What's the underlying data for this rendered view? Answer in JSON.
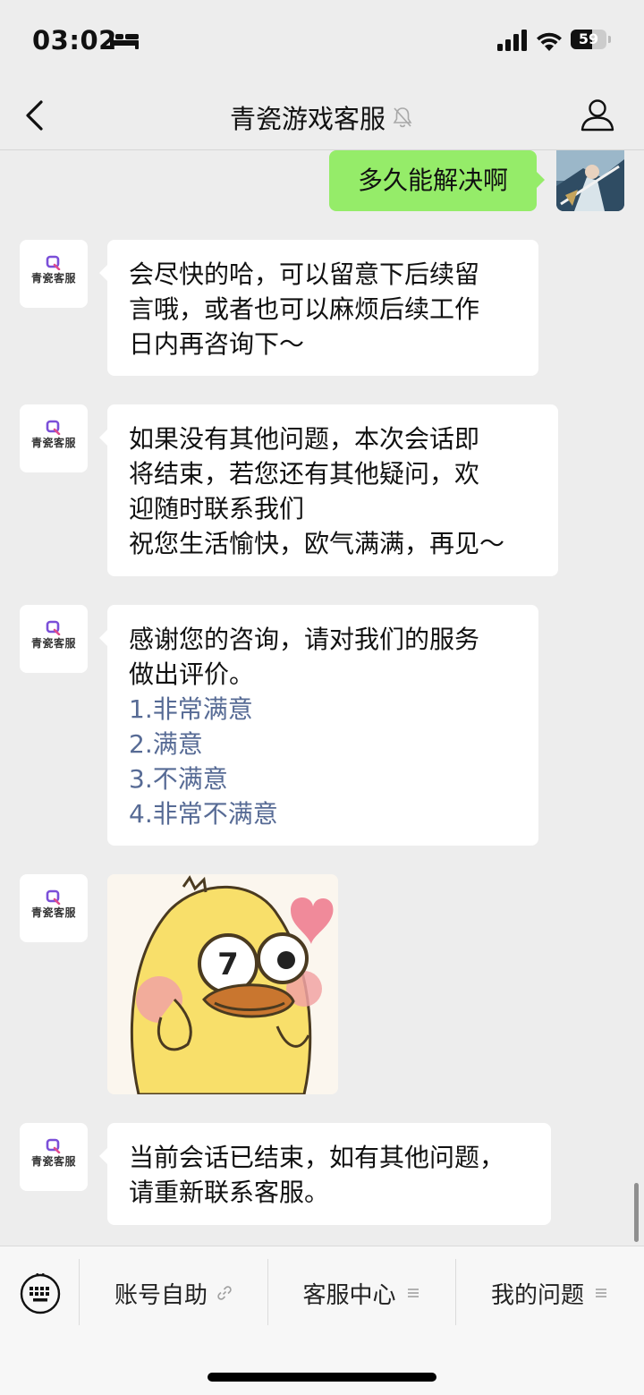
{
  "status_bar": {
    "time": "03:02",
    "battery": "59",
    "battery_level": 0.59
  },
  "nav": {
    "title": "青瓷游戏客服"
  },
  "contact": {
    "avatar_text": "青瓷客服"
  },
  "messages": {
    "sent_1": "多久能解决啊",
    "reply_1": [
      "会尽快的哈，可以留意下后续留",
      "言哦，或者也可以麻烦后续工作",
      "日内再咨询下～"
    ],
    "reply_2": [
      "如果没有其他问题，本次会话即",
      "将结束，若您还有其他疑问，欢",
      "迎随时联系我们",
      "祝您生活愉快，欧气满满，再见～"
    ],
    "survey_text": [
      "感谢您的咨询，请对我们的服务",
      "做出评价。"
    ],
    "survey_options": [
      "1.非常满意",
      "2.满意",
      "3.不满意",
      "4.非常不满意"
    ],
    "closing": [
      "当前会话已结束，如有其他问题，",
      "请重新联系客服。"
    ]
  },
  "bottom_menu": {
    "items": [
      {
        "label": "账号自助",
        "icon": "link-icon"
      },
      {
        "label": "客服中心",
        "icon": "menu-lines-icon"
      },
      {
        "label": "我的问题",
        "icon": "menu-lines-icon"
      }
    ]
  }
}
